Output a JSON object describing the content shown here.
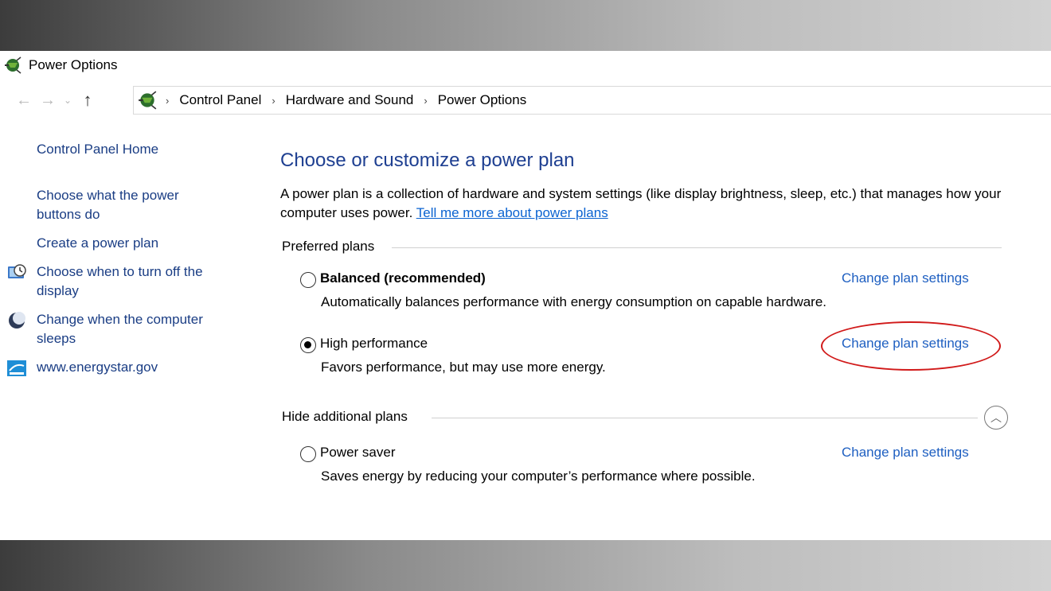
{
  "window": {
    "title": "Power Options"
  },
  "nav": {
    "back": "←",
    "forward": "→",
    "recent": "⌄",
    "up": "↑",
    "breadcrumb": [
      "Control Panel",
      "Hardware and Sound",
      "Power Options"
    ],
    "separator": "›"
  },
  "sidebar": {
    "home": "Control Panel Home",
    "items": [
      {
        "label": "Choose what the power buttons do",
        "icon": null
      },
      {
        "label": "Create a power plan",
        "icon": null
      },
      {
        "label": "Choose when to turn off the display",
        "icon": "display-clock-icon"
      },
      {
        "label": "Change when the computer sleeps",
        "icon": "moon-icon"
      },
      {
        "label": "www.energystar.gov",
        "icon": "energystar-icon"
      }
    ]
  },
  "main": {
    "heading": "Choose or customize a power plan",
    "description": "A power plan is a collection of hardware and system settings (like display brightness, sleep, etc.) that manages how your computer uses power.",
    "learn_more": "Tell me more about power plans",
    "preferred_label": "Preferred plans",
    "hidden_label": "Hide additional plans",
    "plans": [
      {
        "name": "Balanced (recommended)",
        "description": "Automatically balances performance with energy consumption on capable hardware.",
        "selected": false,
        "link": "Change plan settings"
      },
      {
        "name": "High performance",
        "description": "Favors performance, but may use more energy.",
        "selected": true,
        "link": "Change plan settings"
      },
      {
        "name": "Power saver",
        "description": "Saves energy by reducing your computer’s performance where possible.",
        "selected": false,
        "link": "Change plan settings"
      }
    ]
  },
  "colors": {
    "link": "#1e5fc1",
    "heading": "#1e3f91",
    "sidebar_link": "#1a3d84",
    "highlight": "#d11a1a"
  }
}
